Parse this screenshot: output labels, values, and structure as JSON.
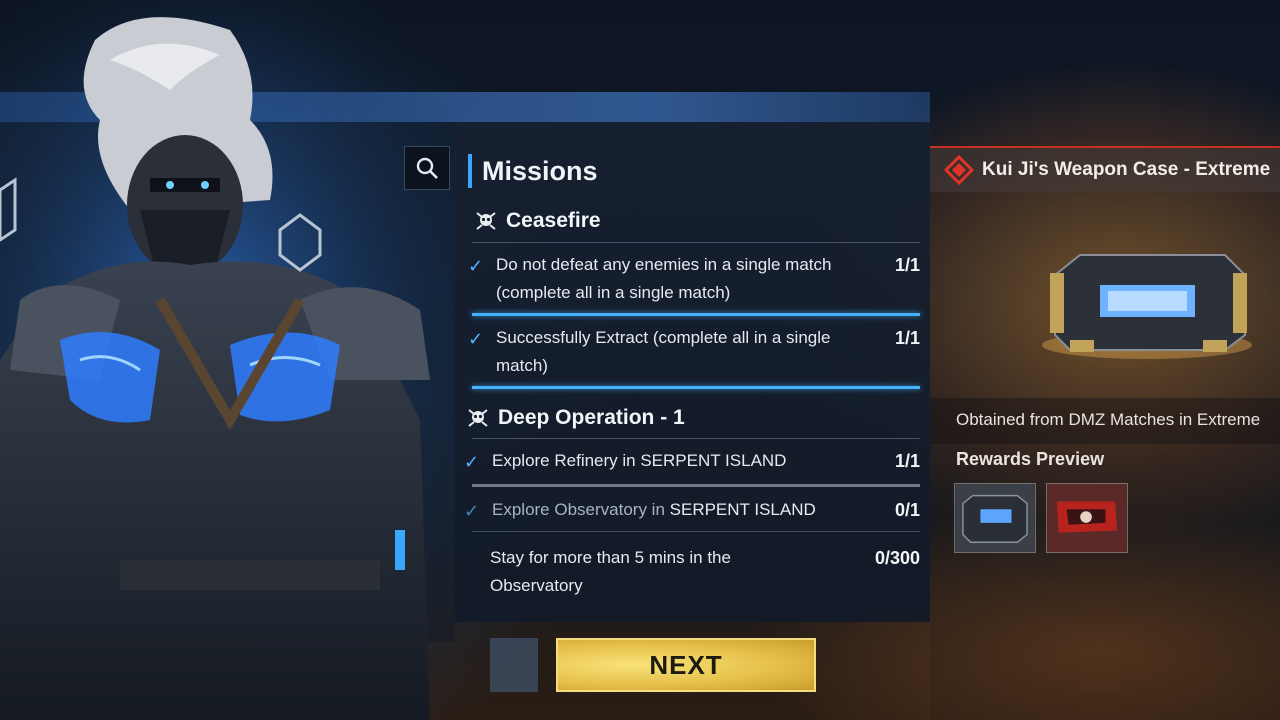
{
  "missions": {
    "title": "Missions",
    "groups": [
      {
        "name": "Ceasefire",
        "tasks": [
          {
            "text": "Do not defeat any enemies in a single match (complete all in a single match)",
            "progress": "1/1"
          },
          {
            "text": "Successfully Extract (complete all in a single match)",
            "progress": "1/1"
          }
        ]
      },
      {
        "name": "Deep Operation - 1",
        "tasks": [
          {
            "text_prefix": "Explore Refinery in ",
            "text_place": "SERPENT ISLAND",
            "progress": "1/1"
          },
          {
            "text_prefix": "Explore Observatory in ",
            "text_place": "SERPENT ISLAND",
            "progress": "0/1"
          },
          {
            "text": "Stay for more than 5 mins in the Observatory",
            "progress": "0/300"
          }
        ]
      }
    ]
  },
  "next_button": {
    "label": "NEXT"
  },
  "reward": {
    "title": "Kui Ji's Weapon Case - Extreme",
    "obtained": "Obtained from DMZ Matches in Extreme",
    "preview_label": "Rewards Preview"
  },
  "colors": {
    "accent_blue": "#46b2ff",
    "next_gold": "#e6c04a",
    "reward_red": "#c8301f"
  }
}
